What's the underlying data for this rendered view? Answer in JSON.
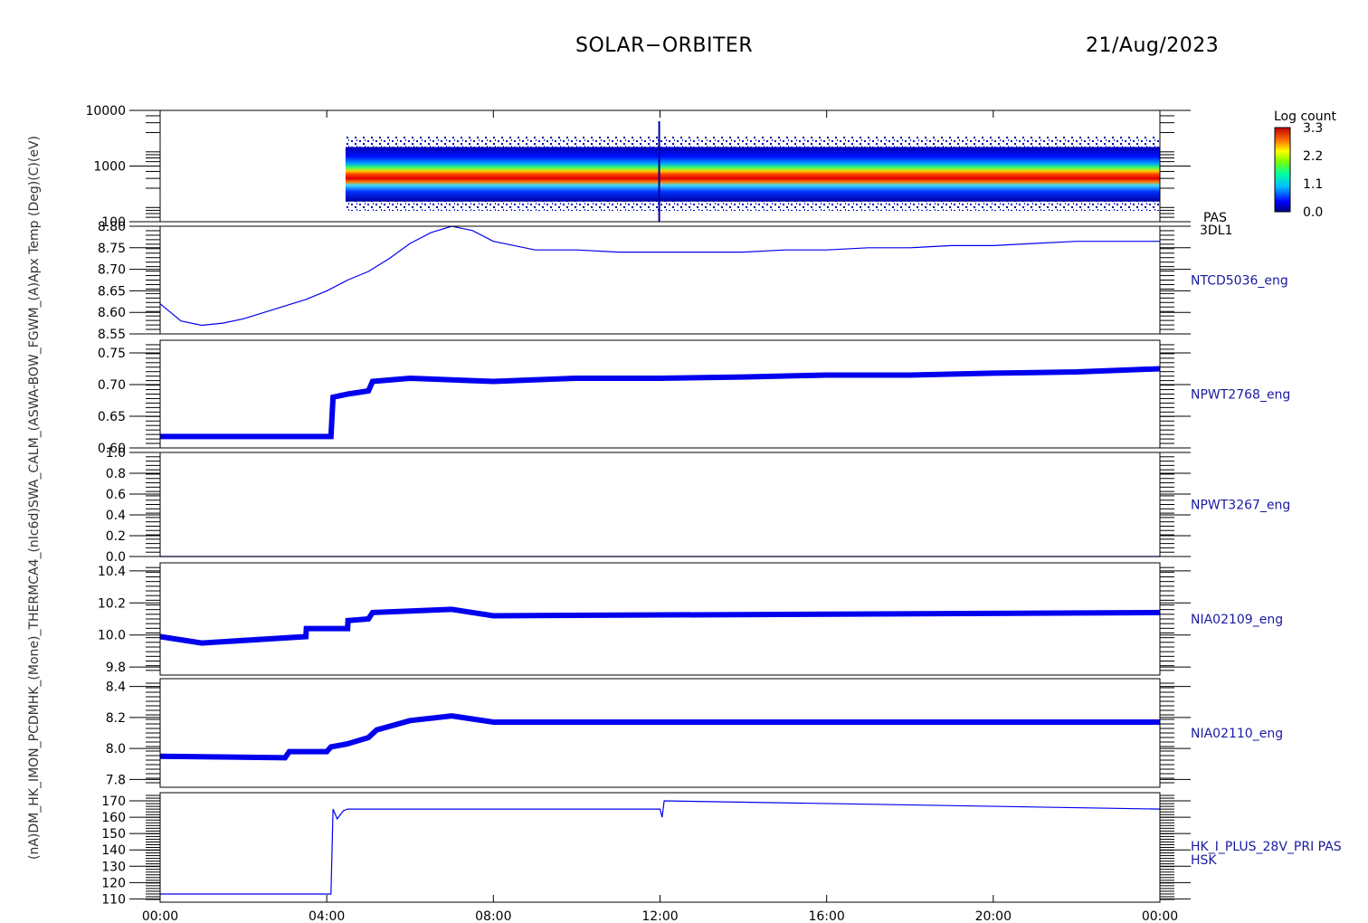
{
  "header": {
    "title": "SOLAR−ORBITER",
    "date": "21/Aug/2023"
  },
  "colorbar": {
    "title": "Log count",
    "ticks": [
      "3.3",
      "2.2",
      "1.1",
      "0.0"
    ]
  },
  "left_label": "(nA)DM_HK_IMON_PCDMHK_(Mone)_THERMCA4_(nIc6d)SWA_CALM_(ASWA-BOW_FGWM_(A)Apx Temp (Deg)(C)(eV)",
  "colors": {
    "trace": "#0000ee",
    "label": "#1a1aa0"
  },
  "chart_data": [
    {
      "type": "heatmap",
      "name": "PAS 3DL1",
      "side_label": [
        "PAS",
        "3DL1"
      ],
      "ylabel": "(eV)",
      "yscale": "log",
      "ylim": [
        100,
        10000
      ],
      "yticks": [
        "10000",
        "1000",
        "100"
      ],
      "colorbar_range": [
        0.0,
        3.3
      ]
    },
    {
      "type": "line",
      "name": "NTCD5036_eng",
      "ylim": [
        8.55,
        8.8
      ],
      "yticks": [
        "8.80",
        "8.75",
        "8.70",
        "8.65",
        "8.60",
        "8.55"
      ],
      "x": [
        0,
        0.5,
        1,
        1.5,
        2,
        2.5,
        3,
        3.5,
        4,
        4.5,
        5,
        5.5,
        6,
        6.5,
        7,
        7.5,
        8,
        9,
        10,
        11,
        12,
        13,
        14,
        15,
        16,
        17,
        18,
        19,
        20,
        21,
        22,
        23,
        24
      ],
      "values": [
        8.62,
        8.58,
        8.57,
        8.575,
        8.585,
        8.6,
        8.615,
        8.63,
        8.65,
        8.675,
        8.695,
        8.725,
        8.76,
        8.785,
        8.8,
        8.79,
        8.765,
        8.745,
        8.745,
        8.74,
        8.74,
        8.74,
        8.74,
        8.745,
        8.745,
        8.75,
        8.75,
        8.755,
        8.755,
        8.76,
        8.765,
        8.765,
        8.765
      ]
    },
    {
      "type": "line",
      "name": "NPWT2768_eng",
      "ylim": [
        0.6,
        0.77
      ],
      "yticks": [
        "0.75",
        "0.70",
        "0.65",
        "0.60"
      ],
      "x": [
        0,
        4.1,
        4.15,
        4.5,
        5,
        5.1,
        6,
        8,
        10,
        12,
        14,
        16,
        18,
        20,
        22,
        24
      ],
      "values": [
        0.618,
        0.618,
        0.68,
        0.685,
        0.69,
        0.705,
        0.71,
        0.705,
        0.71,
        0.71,
        0.712,
        0.715,
        0.715,
        0.718,
        0.72,
        0.725
      ]
    },
    {
      "type": "line",
      "name": "NPWT3267_eng",
      "ylim": [
        0,
        1.0
      ],
      "yticks": [
        "1.0",
        "0.8",
        "0.6",
        "0.4",
        "0.2",
        "0.0"
      ],
      "x": [
        0,
        24
      ],
      "values": [
        0,
        0
      ]
    },
    {
      "type": "line",
      "name": "NIA02109_eng",
      "ylim": [
        9.75,
        10.45
      ],
      "yticks": [
        "10.4",
        "10.2",
        "10.0",
        "9.8"
      ],
      "x": [
        0,
        1,
        3.5,
        3.51,
        4.5,
        4.51,
        5,
        5.1,
        7,
        8,
        24
      ],
      "values": [
        9.99,
        9.95,
        9.99,
        10.04,
        10.04,
        10.09,
        10.1,
        10.14,
        10.16,
        10.12,
        10.14
      ]
    },
    {
      "type": "line",
      "name": "NIA02110_eng",
      "ylim": [
        7.75,
        8.45
      ],
      "yticks": [
        "8.4",
        "8.2",
        "8.0",
        "7.8"
      ],
      "x": [
        0,
        3,
        3.1,
        4,
        4.1,
        4.5,
        5,
        5.2,
        6,
        7,
        8,
        24
      ],
      "values": [
        7.95,
        7.94,
        7.98,
        7.98,
        8.01,
        8.03,
        8.07,
        8.12,
        8.18,
        8.21,
        8.17,
        8.17
      ]
    },
    {
      "type": "line",
      "name": "HK_I_PLUS_28V_PRI PAS HSK",
      "side_label": [
        "HK_I_PLUS_28V_PRI PAS",
        "HSK"
      ],
      "ylim": [
        108,
        175
      ],
      "yticks": [
        "170",
        "160",
        "150",
        "140",
        "130",
        "120",
        "110"
      ],
      "x": [
        0,
        4.1,
        4.15,
        4.25,
        4.4,
        4.5,
        12,
        12.05,
        12.1,
        24
      ],
      "values": [
        113,
        113,
        165,
        159,
        164,
        165,
        165,
        160,
        170,
        165
      ]
    }
  ],
  "x_axis": {
    "ticks": [
      "00:00",
      "04:00",
      "08:00",
      "12:00",
      "16:00",
      "20:00",
      "00:00"
    ]
  }
}
